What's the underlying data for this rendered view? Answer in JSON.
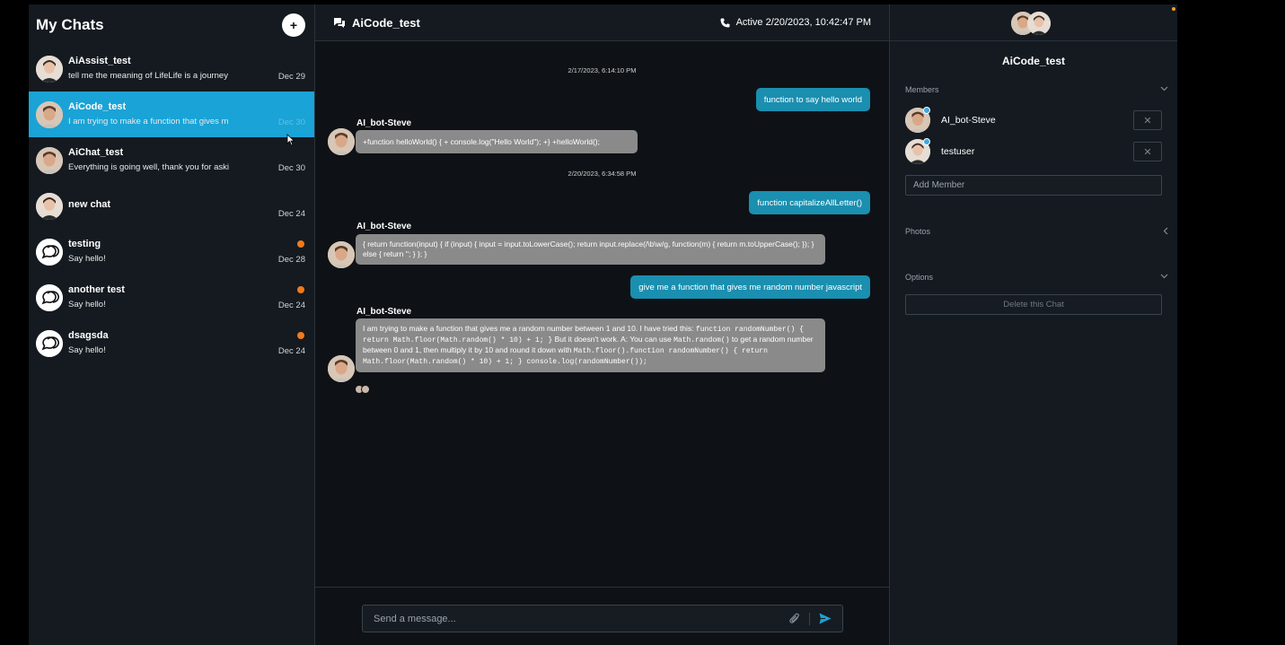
{
  "sidebar": {
    "title": "My Chats",
    "new_chat_label": "+",
    "chats": [
      {
        "name": "AiAssist_test",
        "preview": "tell me the meaning of LifeLife is a journey",
        "date": "Dec 29",
        "unread": false
      },
      {
        "name": "AiCode_test",
        "preview": "I am trying to make a function that gives m",
        "date": "Dec 30",
        "unread": false
      },
      {
        "name": "AiChat_test",
        "preview": "Everything is going well, thank you for aski",
        "date": "Dec 30",
        "unread": false
      },
      {
        "name": "new chat",
        "preview": "",
        "date": "Dec 24",
        "unread": false
      },
      {
        "name": "testing",
        "preview": "Say hello!",
        "date": "Dec 28",
        "unread": true
      },
      {
        "name": "another test",
        "preview": "Say hello!",
        "date": "Dec 24",
        "unread": true
      },
      {
        "name": "dsagsda",
        "preview": "Say hello!",
        "date": "Dec 24",
        "unread": true
      }
    ]
  },
  "header": {
    "title": "AiCode_test",
    "status": "Active 2/20/2023, 10:42:47 PM"
  },
  "messages": {
    "ts1": "2/17/2023, 6:14:10 PM",
    "out1": "function to say hello world",
    "bot_name": "AI_bot-Steve",
    "in1": "+function helloWorld() { + console.log(\"Hello World\"); +} +helloWorld();",
    "ts2": "2/20/2023, 6:34:58 PM",
    "out2": "function capitalizeAllLetter()",
    "in2": "{ return function(input) { if (input) { input = input.toLowerCase(); return input.replace(/\\b\\w/g, function(m) { return m.toUpperCase(); }); } else { return ''; } }; }",
    "out3": "give me a function that gives me random number javascript",
    "in3_a": "I am trying to make a function that gives me a random number between 1 and 10. I have tried this: ",
    "in3_code1": "function randomNumber() { return Math.floor(Math.random() * 10) + 1; }",
    "in3_b": " But it doesn't work. A: You can use ",
    "in3_code2": "Math.random()",
    "in3_c": " to get a random number between 0 and 1, then multiply it by 10 and round it down with ",
    "in3_code3": "Math.floor().function randomNumber() { return Math.floor(Math.random() * 10) + 1; } console.log(randomNumber());"
  },
  "composer": {
    "placeholder": "Send a message..."
  },
  "info": {
    "name": "AiCode_test",
    "members_label": "Members",
    "members": [
      {
        "name": "AI_bot-Steve",
        "remove": "✕"
      },
      {
        "name": "testuser",
        "remove": "✕"
      }
    ],
    "add_member_placeholder": "Add Member",
    "photos_label": "Photos",
    "options_label": "Options",
    "delete_label": "Delete this Chat"
  },
  "colors": {
    "active_chat": "#1aa3d6",
    "outgoing_bubble": "#1a8fb0",
    "incoming_bubble": "#8a8a8a",
    "unread_dot": "#f07a1c"
  }
}
